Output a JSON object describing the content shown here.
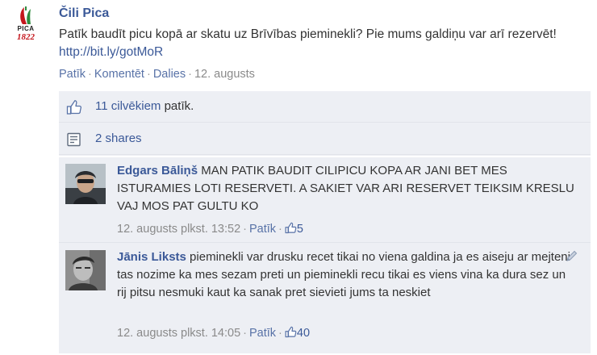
{
  "post": {
    "author": "Čili Pica",
    "logo_text": "PICA",
    "logo_year": "1822",
    "text": "Patīk baudīt picu kopā ar skatu uz Brīvības pieminekli? Pie mums galdiņu var arī rezervēt! ",
    "link": "http://bit.ly/gotMoR",
    "actions": {
      "like": "Patīk",
      "comment": "Komentēt",
      "share": "Dalies",
      "separator": "·",
      "date": "12. augusts"
    }
  },
  "feedback": {
    "likes_link": "11 cilvēkiem",
    "likes_suffix": " patīk.",
    "shares": "2 shares"
  },
  "comments": [
    {
      "author": "Edgars Bāliņš",
      "text": " MAN PATIK BAUDIT CILIPICU KOPA AR JANI BET MES ISTURAMIES LOTI RESERVETI. A SAKIET VAR ARI RESERVET TEIKSIM KRESLU VAJ MOS PAT GULTU KO",
      "time": "12. augusts plkst. 13:52",
      "like": "Patīk",
      "like_count": "5"
    },
    {
      "author": "Jānis Liksts",
      "text": " pieminekli var drusku recet tikai no viena galdina ja es aiseju ar mejteni tas nozime ka mes sezam preti un pieminekli recu tikai es viens vina ka dura sez un rij pitsu nesmuki kaut ka sanak pret sievieti jums ta neskiet",
      "time": "12. augusts plkst. 14:05",
      "like": "Patīk",
      "like_count": "40"
    }
  ],
  "colors": {
    "link": "#3b5998",
    "feedback_bg": "#edeff4",
    "logo_red": "#c4161c"
  }
}
